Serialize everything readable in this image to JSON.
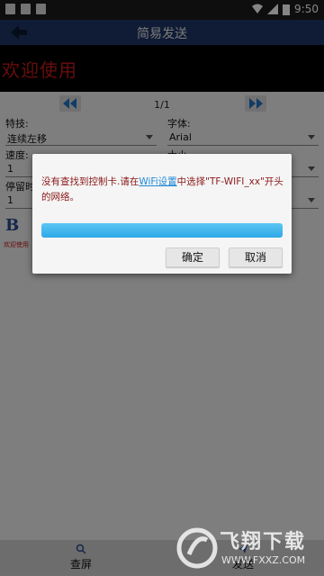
{
  "status": {
    "time": "9:50"
  },
  "header": {
    "title": "简易发送"
  },
  "preview": {
    "text": "欢迎使用"
  },
  "pager": {
    "count": "1/1"
  },
  "form": {
    "effect_label": "特技:",
    "effect_value": "连续左移",
    "font_label": "字体:",
    "font_value": "Arial",
    "speed_label": "速度:",
    "speed_value": "1",
    "size_label": "大小",
    "stay_label": "停留时",
    "stay_value": "1",
    "bold_label": "B",
    "preview_small": "欢迎使用"
  },
  "dialog": {
    "msg_before": "没有查找到控制卡.请在",
    "msg_link": "WiFi设置",
    "msg_after": "中选择\"TF-WIFI_xx\"开头的网络。",
    "progress": 1.0,
    "ok_label": "确定",
    "cancel_label": "取消"
  },
  "bottom_nav": {
    "left_label": "查屏",
    "right_label": "发送"
  },
  "watermark": {
    "line1": "飞翔下载",
    "line2": "WWW.FXXZ.COM"
  },
  "colors": {
    "appbar": "#203766",
    "led_text": "#c81a1a",
    "progress": "#2ea8e6",
    "link": "#1e88d6"
  }
}
